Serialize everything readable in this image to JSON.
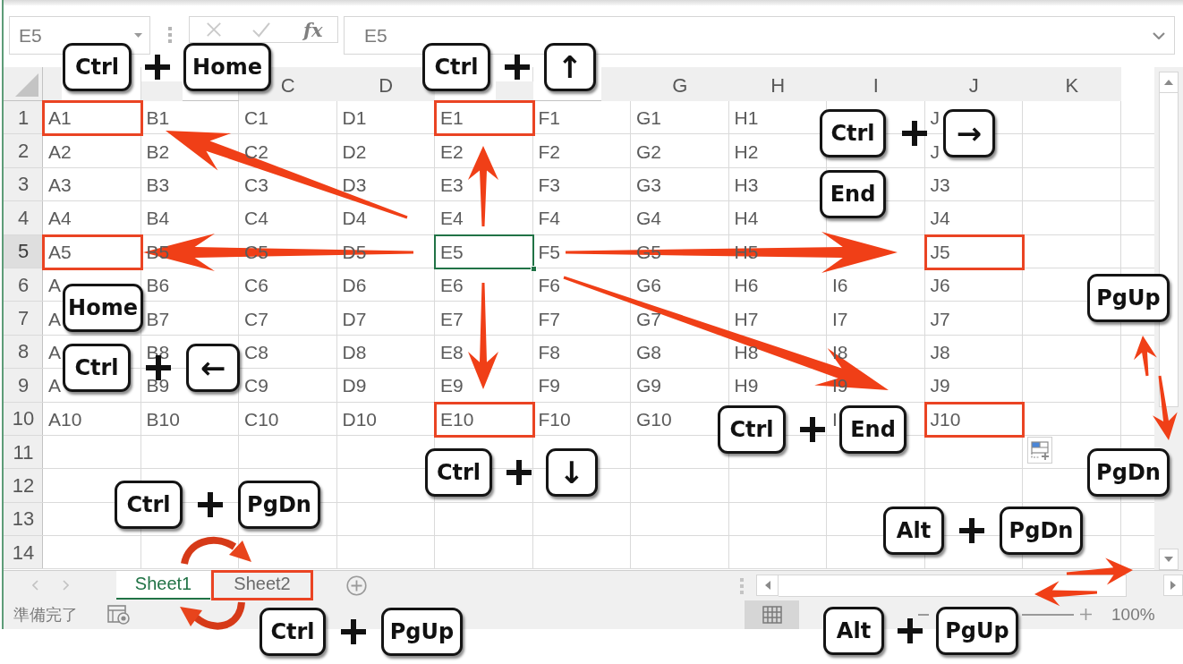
{
  "formula_bar": {
    "name_box": "E5",
    "function_button": "fx",
    "formula": "E5"
  },
  "columns": [
    null,
    null,
    "C",
    "D",
    null,
    null,
    "G",
    "H",
    "I",
    "J",
    "K"
  ],
  "rows": [
    {
      "header": "1",
      "selected": false,
      "cells": [
        {
          "text": "A1",
          "selected": false,
          "highlighted": true
        },
        {
          "text": "B1",
          "selected": false,
          "highlighted": false
        },
        {
          "text": "C1",
          "selected": false,
          "highlighted": false
        },
        {
          "text": "D1",
          "selected": false,
          "highlighted": false
        },
        {
          "text": "E1",
          "selected": false,
          "highlighted": true
        },
        {
          "text": "F1",
          "selected": false,
          "highlighted": false
        },
        {
          "text": "G1",
          "selected": false,
          "highlighted": false
        },
        {
          "text": "H1",
          "selected": false,
          "highlighted": false
        },
        null,
        {
          "text": "J",
          "selected": false,
          "highlighted": false
        }
      ]
    },
    {
      "header": "2",
      "selected": false,
      "cells": [
        {
          "text": "A2",
          "selected": false,
          "highlighted": false
        },
        {
          "text": "B2",
          "selected": false,
          "highlighted": false
        },
        {
          "text": "C2",
          "selected": false,
          "highlighted": false
        },
        {
          "text": "D2",
          "selected": false,
          "highlighted": false
        },
        {
          "text": "E2",
          "selected": false,
          "highlighted": false
        },
        {
          "text": "F2",
          "selected": false,
          "highlighted": false
        },
        {
          "text": "G2",
          "selected": false,
          "highlighted": false
        },
        {
          "text": "H2",
          "selected": false,
          "highlighted": false
        },
        null,
        {
          "text": "J",
          "selected": false,
          "highlighted": false
        }
      ]
    },
    {
      "header": "3",
      "selected": false,
      "cells": [
        {
          "text": "A3",
          "selected": false,
          "highlighted": false
        },
        {
          "text": "B3",
          "selected": false,
          "highlighted": false
        },
        {
          "text": "C3",
          "selected": false,
          "highlighted": false
        },
        {
          "text": "D3",
          "selected": false,
          "highlighted": false
        },
        {
          "text": "E3",
          "selected": false,
          "highlighted": false
        },
        {
          "text": "F3",
          "selected": false,
          "highlighted": false
        },
        {
          "text": "G3",
          "selected": false,
          "highlighted": false
        },
        {
          "text": "H3",
          "selected": false,
          "highlighted": false
        },
        null,
        {
          "text": "J3",
          "selected": false,
          "highlighted": false
        }
      ]
    },
    {
      "header": "4",
      "selected": false,
      "cells": [
        {
          "text": "A4",
          "selected": false,
          "highlighted": false
        },
        {
          "text": "B4",
          "selected": false,
          "highlighted": false
        },
        {
          "text": "C4",
          "selected": false,
          "highlighted": false
        },
        {
          "text": "D4",
          "selected": false,
          "highlighted": false
        },
        {
          "text": "E4",
          "selected": false,
          "highlighted": false
        },
        {
          "text": "F4",
          "selected": false,
          "highlighted": false
        },
        {
          "text": "G4",
          "selected": false,
          "highlighted": false
        },
        {
          "text": "H4",
          "selected": false,
          "highlighted": false
        },
        null,
        {
          "text": "J4",
          "selected": false,
          "highlighted": false
        }
      ]
    },
    {
      "header": "5",
      "selected": true,
      "cells": [
        {
          "text": "A5",
          "selected": false,
          "highlighted": true
        },
        {
          "text": "B5",
          "selected": false,
          "highlighted": false
        },
        {
          "text": "C5",
          "selected": false,
          "highlighted": false
        },
        {
          "text": "D5",
          "selected": false,
          "highlighted": false
        },
        {
          "text": "E5",
          "selected": true,
          "highlighted": false
        },
        {
          "text": "F5",
          "selected": false,
          "highlighted": false
        },
        {
          "text": "G5",
          "selected": false,
          "highlighted": false
        },
        {
          "text": "H5",
          "selected": false,
          "highlighted": false
        },
        null,
        {
          "text": "J5",
          "selected": false,
          "highlighted": true
        }
      ]
    },
    {
      "header": "6",
      "selected": false,
      "cells": [
        {
          "text": "A",
          "selected": false,
          "highlighted": false
        },
        {
          "text": "B6",
          "selected": false,
          "highlighted": false
        },
        {
          "text": "C6",
          "selected": false,
          "highlighted": false
        },
        {
          "text": "D6",
          "selected": false,
          "highlighted": false
        },
        {
          "text": "E6",
          "selected": false,
          "highlighted": false
        },
        {
          "text": "F6",
          "selected": false,
          "highlighted": false
        },
        {
          "text": "G6",
          "selected": false,
          "highlighted": false
        },
        {
          "text": "H6",
          "selected": false,
          "highlighted": false
        },
        {
          "text": "I6",
          "selected": false,
          "highlighted": false
        },
        {
          "text": "J6",
          "selected": false,
          "highlighted": false
        }
      ]
    },
    {
      "header": "7",
      "selected": false,
      "cells": [
        {
          "text": "A",
          "selected": false,
          "highlighted": false
        },
        {
          "text": "B7",
          "selected": false,
          "highlighted": false
        },
        {
          "text": "C7",
          "selected": false,
          "highlighted": false
        },
        {
          "text": "D7",
          "selected": false,
          "highlighted": false
        },
        {
          "text": "E7",
          "selected": false,
          "highlighted": false
        },
        {
          "text": "F7",
          "selected": false,
          "highlighted": false
        },
        {
          "text": "G7",
          "selected": false,
          "highlighted": false
        },
        {
          "text": "H7",
          "selected": false,
          "highlighted": false
        },
        {
          "text": "I7",
          "selected": false,
          "highlighted": false
        },
        {
          "text": "J7",
          "selected": false,
          "highlighted": false
        }
      ]
    },
    {
      "header": "8",
      "selected": false,
      "cells": [
        {
          "text": "A",
          "selected": false,
          "highlighted": false
        },
        {
          "text": "B8",
          "selected": false,
          "highlighted": false
        },
        {
          "text": "C8",
          "selected": false,
          "highlighted": false
        },
        {
          "text": "D8",
          "selected": false,
          "highlighted": false
        },
        {
          "text": "E8",
          "selected": false,
          "highlighted": false
        },
        {
          "text": "F8",
          "selected": false,
          "highlighted": false
        },
        {
          "text": "G8",
          "selected": false,
          "highlighted": false
        },
        {
          "text": "H8",
          "selected": false,
          "highlighted": false
        },
        {
          "text": "I8",
          "selected": false,
          "highlighted": false
        },
        {
          "text": "J8",
          "selected": false,
          "highlighted": false
        }
      ]
    },
    {
      "header": "9",
      "selected": false,
      "cells": [
        {
          "text": "A",
          "selected": false,
          "highlighted": false
        },
        {
          "text": "B9",
          "selected": false,
          "highlighted": false
        },
        {
          "text": "C9",
          "selected": false,
          "highlighted": false
        },
        {
          "text": "D9",
          "selected": false,
          "highlighted": false
        },
        {
          "text": "E9",
          "selected": false,
          "highlighted": false
        },
        {
          "text": "F9",
          "selected": false,
          "highlighted": false
        },
        {
          "text": "G9",
          "selected": false,
          "highlighted": false
        },
        {
          "text": "H9",
          "selected": false,
          "highlighted": false
        },
        {
          "text": "I9",
          "selected": false,
          "highlighted": false
        },
        {
          "text": "J9",
          "selected": false,
          "highlighted": false
        }
      ]
    },
    {
      "header": "10",
      "selected": false,
      "cells": [
        {
          "text": "A10",
          "selected": false,
          "highlighted": false
        },
        {
          "text": "B10",
          "selected": false,
          "highlighted": false
        },
        {
          "text": "C10",
          "selected": false,
          "highlighted": false
        },
        {
          "text": "D10",
          "selected": false,
          "highlighted": false
        },
        {
          "text": "E10",
          "selected": false,
          "highlighted": true
        },
        {
          "text": "F10",
          "selected": false,
          "highlighted": false
        },
        {
          "text": "G10",
          "selected": false,
          "highlighted": false
        },
        null,
        {
          "text": "I",
          "selected": false,
          "highlighted": false
        },
        {
          "text": "J10",
          "selected": false,
          "highlighted": true
        }
      ]
    },
    {
      "header": "11",
      "selected": false
    },
    {
      "header": "12",
      "selected": false
    },
    {
      "header": "13",
      "selected": false
    },
    {
      "header": "14",
      "selected": false
    }
  ],
  "sheet_tabs": [
    {
      "label": "Sheet1",
      "selected": true,
      "highlighted": false
    },
    {
      "label": "Sheet2",
      "selected": false,
      "highlighted": true
    }
  ],
  "status_bar": {
    "status": "準備完了",
    "view_buttons": [
      {
        "kind": "normal",
        "selected": true
      }
    ],
    "zoom": "100%"
  },
  "shortcuts": [
    {
      "keys": [
        {
          "kind": "word",
          "label": "Ctrl"
        },
        {
          "kind": "word",
          "label": "Home"
        }
      ]
    },
    {
      "keys": [
        {
          "kind": "word",
          "label": "Ctrl"
        },
        {
          "kind": "arrow",
          "label": "↑"
        }
      ]
    },
    {
      "keys": [
        {
          "kind": "word",
          "label": "Ctrl"
        },
        {
          "kind": "arrow",
          "label": "→"
        }
      ]
    },
    {
      "keys": [
        {
          "kind": "word",
          "label": "End"
        }
      ]
    },
    {
      "keys": [
        {
          "kind": "word",
          "label": "PgUp"
        }
      ]
    },
    {
      "keys": [
        {
          "kind": "word",
          "label": "Home"
        }
      ]
    },
    {
      "keys": [
        {
          "kind": "word",
          "label": "Ctrl"
        },
        {
          "kind": "arrow",
          "label": "←"
        }
      ]
    },
    {
      "keys": [
        {
          "kind": "word",
          "label": "Ctrl"
        },
        {
          "kind": "word",
          "label": "End"
        }
      ]
    },
    {
      "keys": [
        {
          "kind": "word",
          "label": "Ctrl"
        },
        {
          "kind": "arrow",
          "label": "↓"
        }
      ]
    },
    {
      "keys": [
        {
          "kind": "word",
          "label": "PgDn"
        }
      ]
    },
    {
      "keys": [
        {
          "kind": "word",
          "label": "Ctrl"
        },
        {
          "kind": "word",
          "label": "PgDn"
        }
      ]
    },
    {
      "keys": [
        {
          "kind": "word",
          "label": "Alt"
        },
        {
          "kind": "word",
          "label": "PgDn"
        }
      ]
    },
    {
      "keys": [
        {
          "kind": "word",
          "label": "Ctrl"
        },
        {
          "kind": "word",
          "label": "PgUp"
        }
      ]
    },
    {
      "keys": [
        {
          "kind": "word",
          "label": "Alt"
        },
        {
          "kind": "word",
          "label": "PgUp"
        }
      ]
    }
  ]
}
